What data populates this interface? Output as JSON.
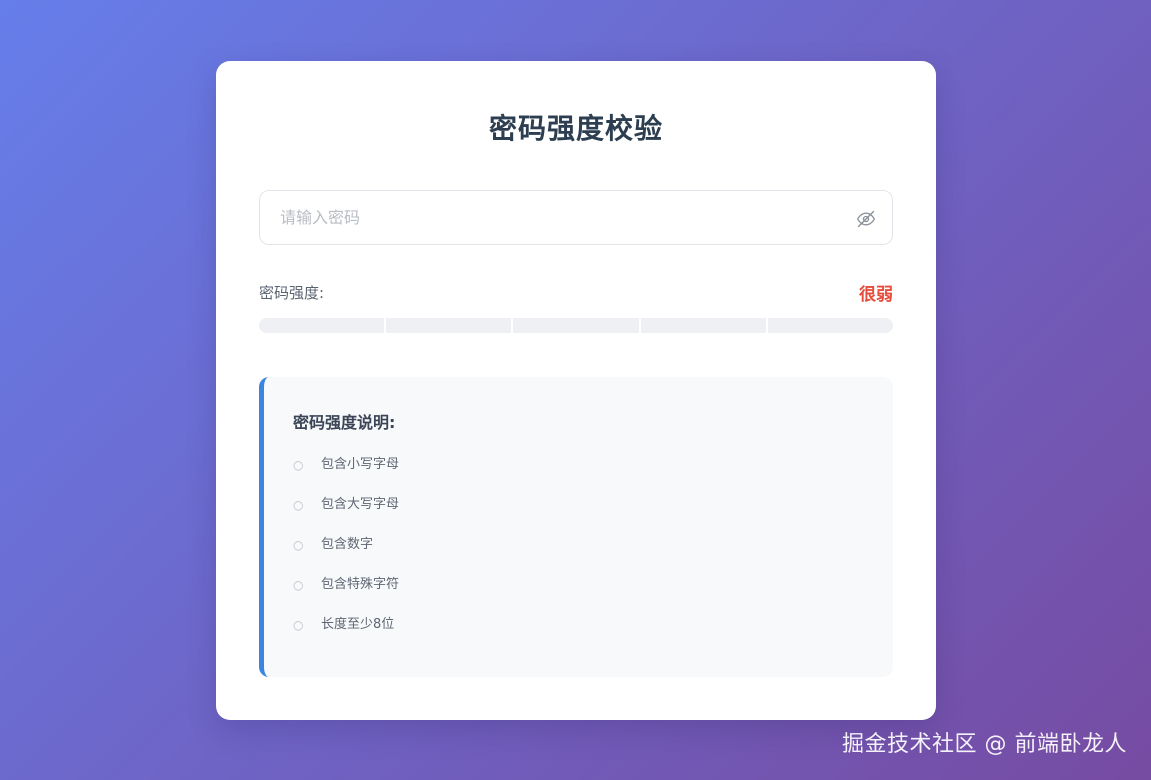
{
  "title": "密码强度校验",
  "input": {
    "placeholder": "请输入密码",
    "value": "",
    "toggle_icon": "eye-slash-icon"
  },
  "strength": {
    "label": "密码强度:",
    "level_text": "很弱",
    "level_color": "#e74c3c",
    "segments_total": 5,
    "segments_filled": 0
  },
  "requirements": {
    "title": "密码强度说明:",
    "status_icon": "circle-outline-icon",
    "items": [
      {
        "text": "包含小写字母",
        "met": false
      },
      {
        "text": "包含大写字母",
        "met": false
      },
      {
        "text": "包含数字",
        "met": false
      },
      {
        "text": "包含特殊字符",
        "met": false
      },
      {
        "text": "长度至少8位",
        "met": false
      }
    ]
  },
  "colors": {
    "accent": "#3a85e0",
    "bg_gradient_start": "#667eea",
    "bg_gradient_end": "#764ba2"
  },
  "watermark": "掘金技术社区 @ 前端卧龙人"
}
